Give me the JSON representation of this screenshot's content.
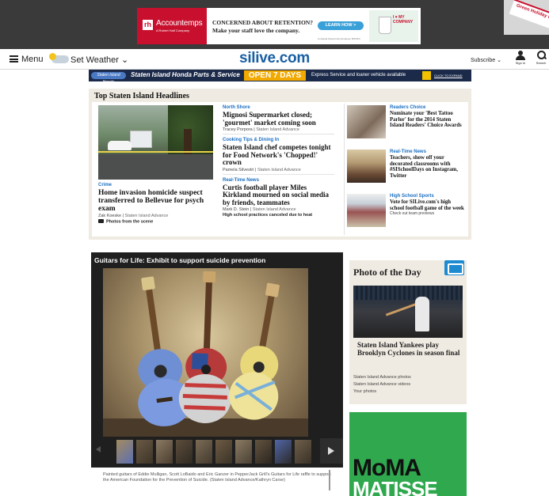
{
  "top_ad": {
    "brand": "Accountemps",
    "brand_sub": "A Robert Half Company",
    "headline_1": "CONCERNED ABOUT RETENTION?",
    "headline_2": "Make your staff love the company.",
    "cta": "LEARN HOW >",
    "fine_print": "An Equal Opportunity Employer M/F/D/V",
    "cup_text": "I ♥ MY COMPANY"
  },
  "corner_ad": {
    "text": "Green Holiday Parts"
  },
  "nav": {
    "menu": "Menu",
    "weather": "Set Weather",
    "logo": "silive.com",
    "subscribe": "Subscribe",
    "sign_in": "Sign In",
    "search": "Search"
  },
  "honda_ad": {
    "badge": "Staten Island Honda",
    "title": "Staten Island Honda Parts & Service",
    "open": "OPEN 7 DAYS",
    "desc": "Express Service and loaner vehicle available",
    "cta": "CLICK TO EXPAND"
  },
  "headlines": {
    "title": "Top Staten Island Headlines",
    "lead": {
      "kicker": "Crime",
      "headline": "Home invasion homicide suspect transferred to Bellevue for psych exam",
      "author": "Zak Koeske",
      "source": "Staten Island Advance",
      "photos": "Photos from the scene"
    },
    "middle": [
      {
        "kicker": "North Shore",
        "headline": "Mignosi Supermarket closed; 'gourmet' market coming soon",
        "author": "Tracey Porpora",
        "source": "Staten Island Advance"
      },
      {
        "kicker": "Cooking Tips & Dining In",
        "headline": "Staten Island chef competes tonight for Food Network's 'Chopped!' crown",
        "author": "Pamela Silvestri",
        "source": "Staten Island Advance"
      },
      {
        "kicker": "Real-Time News",
        "headline": "Curtis football player Miles Kirkland mourned on social media by friends, teammates",
        "author": "Mark D. Stein",
        "source": "Staten Island Advance",
        "extra": "High school practices canceled due to heat"
      }
    ],
    "right": [
      {
        "kicker": "Readers Choice",
        "headline": "Nominate your 'Best Tattoo Parlor' for the 2014 Staten Island Readers' Choice Awards",
        "byline": ""
      },
      {
        "kicker": "Real-Time News",
        "headline": "Teachers, show off your decorated classrooms with #SISchoolDays on Instagram, Twitter",
        "byline": ""
      },
      {
        "kicker": "High School Sports",
        "headline": "Vote for SILive.com's high school football game of the week",
        "byline": "Check out team previews"
      }
    ]
  },
  "gallery": {
    "title": "Guitars for Life: Exhibit to support suicide prevention",
    "caption": "Painted guitars of Eddie Mulligan, Scott LoBaido and Eric Ganzer in PepperJack Grill's Guitars for Life raffle to support the American Foundation for the Prevention of Suicide. (Staten Island Advance/Kathryn Carse)"
  },
  "photo_of_day": {
    "title": "Photo of the Day",
    "caption": "Staten Island Yankees play Brooklyn Cyclones in season final",
    "links": [
      "Staten Island Advance photos",
      "Staten Island Advance videos",
      "Your photos"
    ]
  },
  "moma_ad": {
    "line1": "MoMA",
    "line2": "MATISSE"
  }
}
